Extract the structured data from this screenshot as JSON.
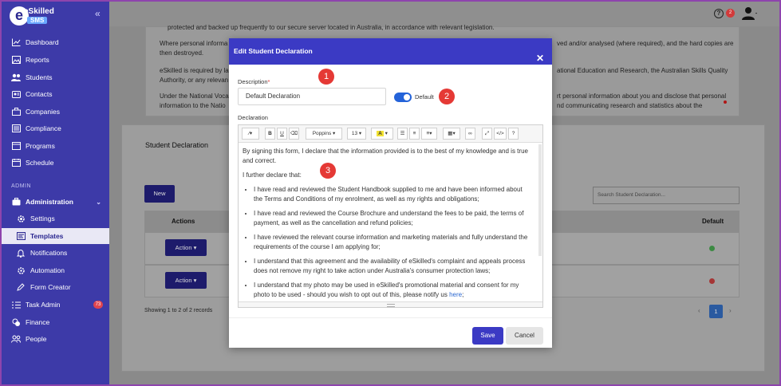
{
  "brand": {
    "name": "eSkilled",
    "product": "SMS"
  },
  "sidebar": {
    "collapse_icon": "«",
    "section_admin": "ADMIN",
    "items": [
      {
        "label": "Dashboard",
        "icon": "chart-line-icon"
      },
      {
        "label": "Reports",
        "icon": "image-icon"
      },
      {
        "label": "Students",
        "icon": "users-icon"
      },
      {
        "label": "Contacts",
        "icon": "contact-card-icon"
      },
      {
        "label": "Companies",
        "icon": "building-icon"
      },
      {
        "label": "Compliance",
        "icon": "list-icon"
      },
      {
        "label": "Programs",
        "icon": "window-icon"
      },
      {
        "label": "Schedule",
        "icon": "calendar-icon"
      }
    ],
    "admin_items": [
      {
        "label": "Administration",
        "icon": "briefcase-icon"
      },
      {
        "label": "Settings",
        "icon": "gear-icon"
      },
      {
        "label": "Templates",
        "icon": "template-icon"
      },
      {
        "label": "Notifications",
        "icon": "bell-icon"
      },
      {
        "label": "Automation",
        "icon": "cog-icon"
      },
      {
        "label": "Form Creator",
        "icon": "pencil-icon"
      },
      {
        "label": "Task Admin",
        "icon": "list-icon",
        "badge": "73"
      },
      {
        "label": "Finance",
        "icon": "coins-icon"
      },
      {
        "label": "People",
        "icon": "people-icon"
      }
    ]
  },
  "topbar": {
    "help_badge": "2"
  },
  "background": {
    "line1": "protected and backed up frequently to our secure server located in Australia, in accordance with relevant legislation.",
    "bullet1a": "Where personal informa",
    "bullet1b": "ved and/or analysed (where required), and the hard copies are",
    "bullet1c": "then destroyed.",
    "bullet2a": "eSkilled is required by la",
    "bullet2b": "ational Education and Research, the Australian Skills Quality",
    "bullet2c": "Authority, or any relevan",
    "bullet3a": "Under the National Voca",
    "bullet3b": "rt personal information about you and disclose that personal",
    "bullet3c": "information to the Natio",
    "bullet3d": "nd communicating research and statistics about the",
    "section_title": "Student Declaration",
    "new_button": "New",
    "search_placeholder": "Search Student Declaration...",
    "col_actions": "Actions",
    "col_default": "Default",
    "action_label": "Action",
    "showing": "Showing 1 to 2 of 2 records",
    "page": "1"
  },
  "modal": {
    "title": "Edit Student Declaration",
    "close": "✕",
    "description_label": "Description",
    "required_mark": "*",
    "description_value": "Default Declaration",
    "default_label": "Default",
    "declaration_label": "Declaration",
    "toolbar": {
      "font": "Poppins",
      "size": "13"
    },
    "body": {
      "p1": "By signing this form, I declare that the information provided is to the best of my knowledge and is true and correct.",
      "p2": "I further declare that:",
      "li1": "I have read and reviewed the Student Handbook supplied to me and have been informed about the Terms and Conditions of my enrolment, as well as my rights and obligations;",
      "li2": "I have read and reviewed the Course Brochure and understand the fees to be paid, the terms of payment, as well as the cancellation and refund policies;",
      "li3": "I have reviewed the relevant course information and marketing materials and fully understand the requirements of the course I am applying for;",
      "li4": "I understand that this agreement and the availability of eSkilled's complaint and appeals process does not remove my right to take action under Australia's consumer protection laws;",
      "li5": "I understand that my photo may be used in eSkilled's promotional material and consent for my photo to be used - should you wish to opt out of this, please notify us",
      "li5_link": "here",
      "li5_end": ";"
    },
    "save": "Save",
    "cancel": "Cancel"
  },
  "annotations": [
    "1",
    "2",
    "3"
  ]
}
